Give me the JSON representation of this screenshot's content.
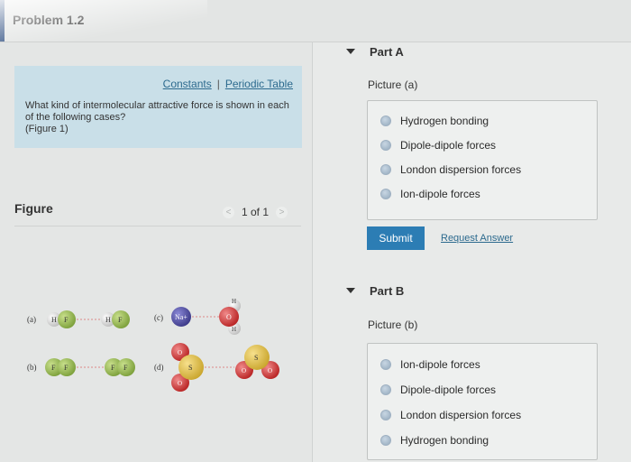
{
  "header": {
    "title": "Problem 1.2"
  },
  "intro": {
    "constants_link": "Constants",
    "separator": "|",
    "periodic_table_link": "Periodic Table",
    "question": "What kind of intermolecular attractive force is shown in each of the following cases?",
    "figure_ref": "(Figure 1)"
  },
  "figure": {
    "label": "Figure",
    "pager": "1 of 1",
    "prev": "<",
    "next": ">",
    "labels": {
      "a": "(a)",
      "b": "(b)",
      "c": "(c)",
      "d": "(d)"
    },
    "atoms": {
      "H": "H",
      "F": "F",
      "Na": "Na+",
      "O": "O",
      "S": "S"
    },
    "colors": {
      "H": "#e6e6e6",
      "F": "#9bbf5b",
      "Na": "#4d4b9e",
      "O": "#d83a3a",
      "S": "#e0c24a"
    }
  },
  "part_a": {
    "heading": "Part A",
    "picture": "Picture (a)",
    "options": [
      "Hydrogen bonding",
      "Dipole-dipole forces",
      "London dispersion forces",
      "Ion-dipole forces"
    ],
    "submit": "Submit",
    "request": "Request Answer"
  },
  "part_b": {
    "heading": "Part B",
    "picture": "Picture (b)",
    "options": [
      "Ion-dipole forces",
      "Dipole-dipole forces",
      "London dispersion forces",
      "Hydrogen bonding"
    ]
  }
}
